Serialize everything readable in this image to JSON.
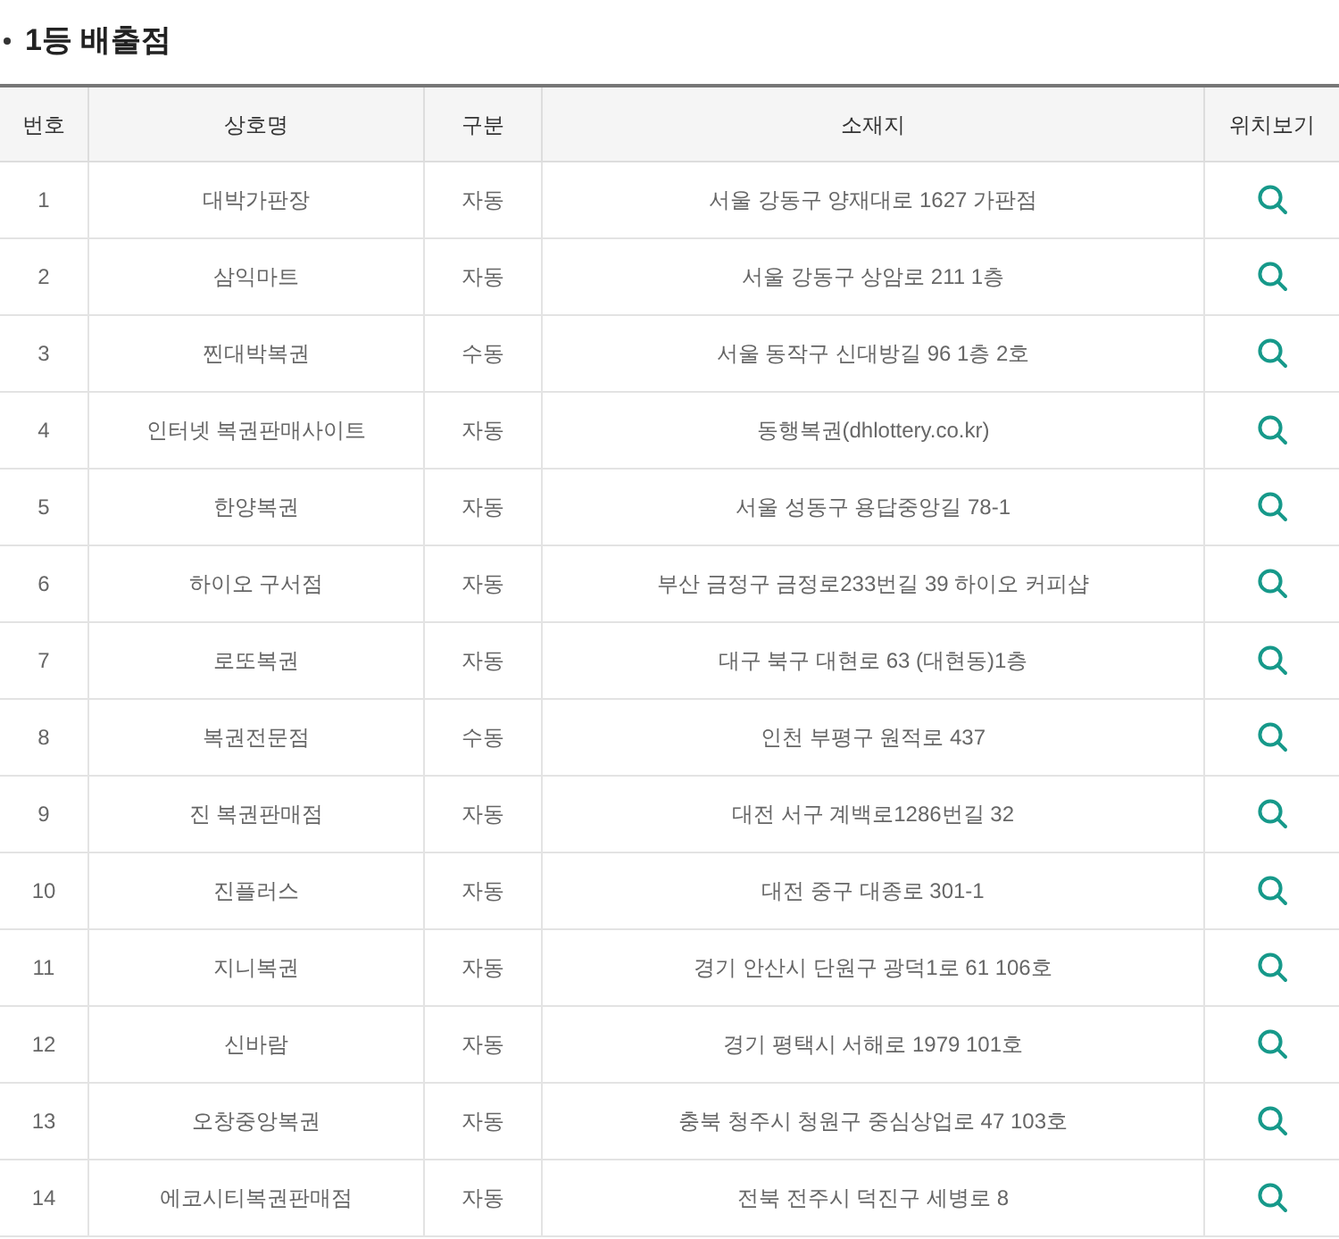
{
  "title": "1등 배출점",
  "table": {
    "columns": [
      "번호",
      "상호명",
      "구분",
      "소재지",
      "위치보기"
    ],
    "rows": [
      {
        "no": "1",
        "name": "대박가판장",
        "type": "자동",
        "address": "서울 강동구 양재대로 1627 가판점"
      },
      {
        "no": "2",
        "name": "삼익마트",
        "type": "자동",
        "address": "서울 강동구 상암로 211 1층"
      },
      {
        "no": "3",
        "name": "찐대박복권",
        "type": "수동",
        "address": "서울 동작구 신대방길 96 1층 2호"
      },
      {
        "no": "4",
        "name": "인터넷 복권판매사이트",
        "type": "자동",
        "address": "동행복권(dhlottery.co.kr)"
      },
      {
        "no": "5",
        "name": "한양복권",
        "type": "자동",
        "address": "서울 성동구 용답중앙길 78-1"
      },
      {
        "no": "6",
        "name": "하이오 구서점",
        "type": "자동",
        "address": "부산 금정구 금정로233번길 39 하이오 커피샵"
      },
      {
        "no": "7",
        "name": "로또복권",
        "type": "자동",
        "address": "대구 북구 대현로 63 (대현동)1층"
      },
      {
        "no": "8",
        "name": "복권전문점",
        "type": "수동",
        "address": "인천 부평구 원적로 437"
      },
      {
        "no": "9",
        "name": "진 복권판매점",
        "type": "자동",
        "address": "대전 서구 계백로1286번길 32"
      },
      {
        "no": "10",
        "name": "진플러스",
        "type": "자동",
        "address": "대전 중구 대종로 301-1"
      },
      {
        "no": "11",
        "name": "지니복권",
        "type": "자동",
        "address": "경기 안산시 단원구 광덕1로 61 106호"
      },
      {
        "no": "12",
        "name": "신바람",
        "type": "자동",
        "address": "경기 평택시 서해로 1979 101호"
      },
      {
        "no": "13",
        "name": "오창중앙복권",
        "type": "자동",
        "address": "충북 청주시 청원구 중심상업로 47 103호"
      },
      {
        "no": "14",
        "name": "에코시티복권판매점",
        "type": "자동",
        "address": "전북 전주시 덕진구 세병로 8"
      }
    ]
  }
}
